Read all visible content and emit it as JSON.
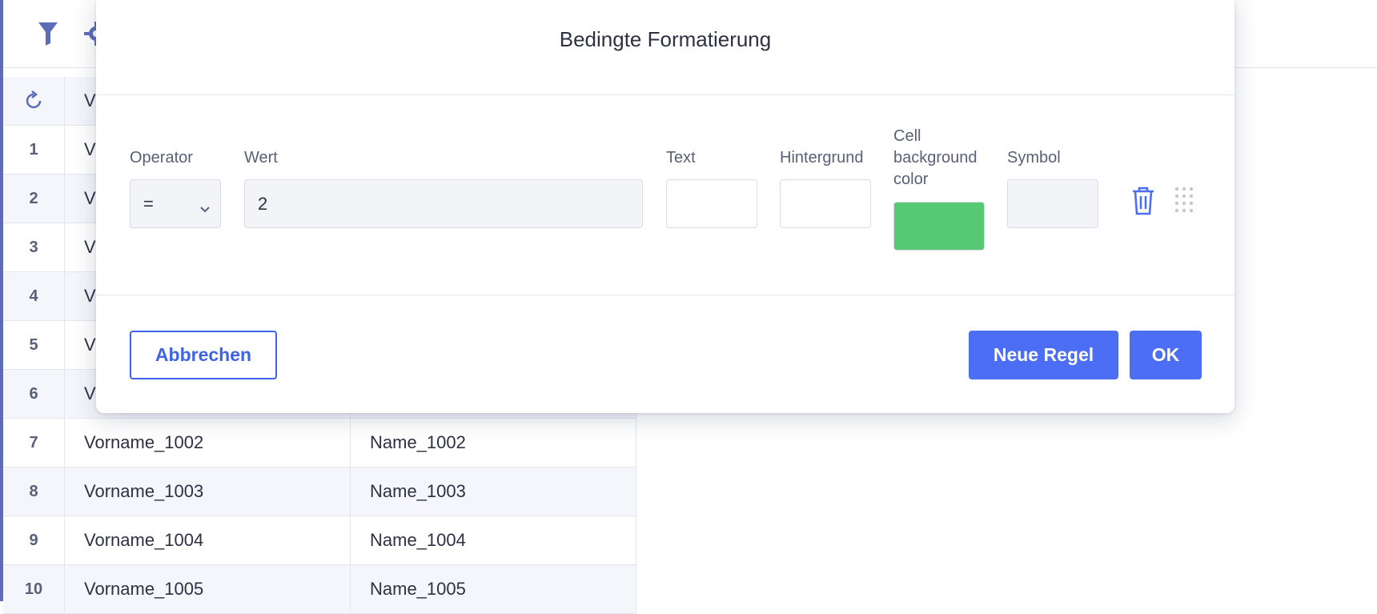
{
  "toolbar": {
    "icons": [
      "filter-icon",
      "gear-icon"
    ]
  },
  "grid": {
    "header": {
      "refresh_icon": "refresh-icon",
      "col1": "V"
    },
    "rows": [
      {
        "num": "1",
        "first": "V",
        "last": ""
      },
      {
        "num": "2",
        "first": "V",
        "last": ""
      },
      {
        "num": "3",
        "first": "V",
        "last": ""
      },
      {
        "num": "4",
        "first": "V",
        "last": ""
      },
      {
        "num": "5",
        "first": "V",
        "last": ""
      },
      {
        "num": "6",
        "first": "V",
        "last": ""
      },
      {
        "num": "7",
        "first": "Vorname_1002",
        "last": "Name_1002"
      },
      {
        "num": "8",
        "first": "Vorname_1003",
        "last": "Name_1003"
      },
      {
        "num": "9",
        "first": "Vorname_1004",
        "last": "Name_1004"
      },
      {
        "num": "10",
        "first": "Vorname_1005",
        "last": "Name_1005"
      }
    ]
  },
  "modal": {
    "title": "Bedingte Formatierung",
    "labels": {
      "operator": "Operator",
      "wert": "Wert",
      "text": "Text",
      "hintergrund": "Hintergrund",
      "cell_bg_line1": "Cell",
      "cell_bg_line2": "background",
      "cell_bg_line3": "color",
      "symbol": "Symbol"
    },
    "rule": {
      "operator_value": "=",
      "wert_value": "2",
      "text_color": "",
      "hintergrund_color": "",
      "cell_background_color": "#57c975",
      "symbol": ""
    },
    "buttons": {
      "cancel": "Abbrechen",
      "new_rule": "Neue Regel",
      "ok": "OK"
    }
  },
  "colors": {
    "accent": "#4c6ef5",
    "accent_dark": "#3f63e8",
    "icon": "#5b6db8"
  }
}
